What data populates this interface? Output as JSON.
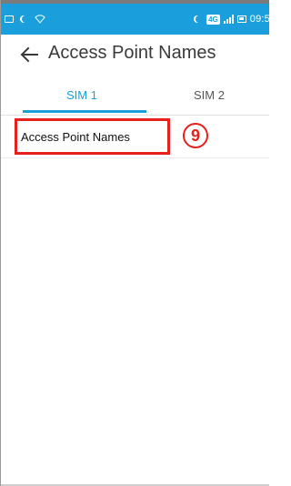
{
  "status_bar": {
    "network_badge": "4G",
    "time": "09:5",
    "background_color": "#1a9fdc"
  },
  "header": {
    "title": "Access Point Names",
    "back_icon": "arrow-left-icon"
  },
  "tabs": [
    {
      "label": "SIM 1",
      "selected": true
    },
    {
      "label": "SIM 2",
      "selected": false
    }
  ],
  "list": {
    "items": [
      {
        "label": "Access Point Names"
      }
    ]
  },
  "annotation": {
    "step_marker": "9",
    "highlight_color": "#e8201b"
  },
  "colors": {
    "accent": "#1a9fdc",
    "title_text": "#3a3a3a"
  }
}
